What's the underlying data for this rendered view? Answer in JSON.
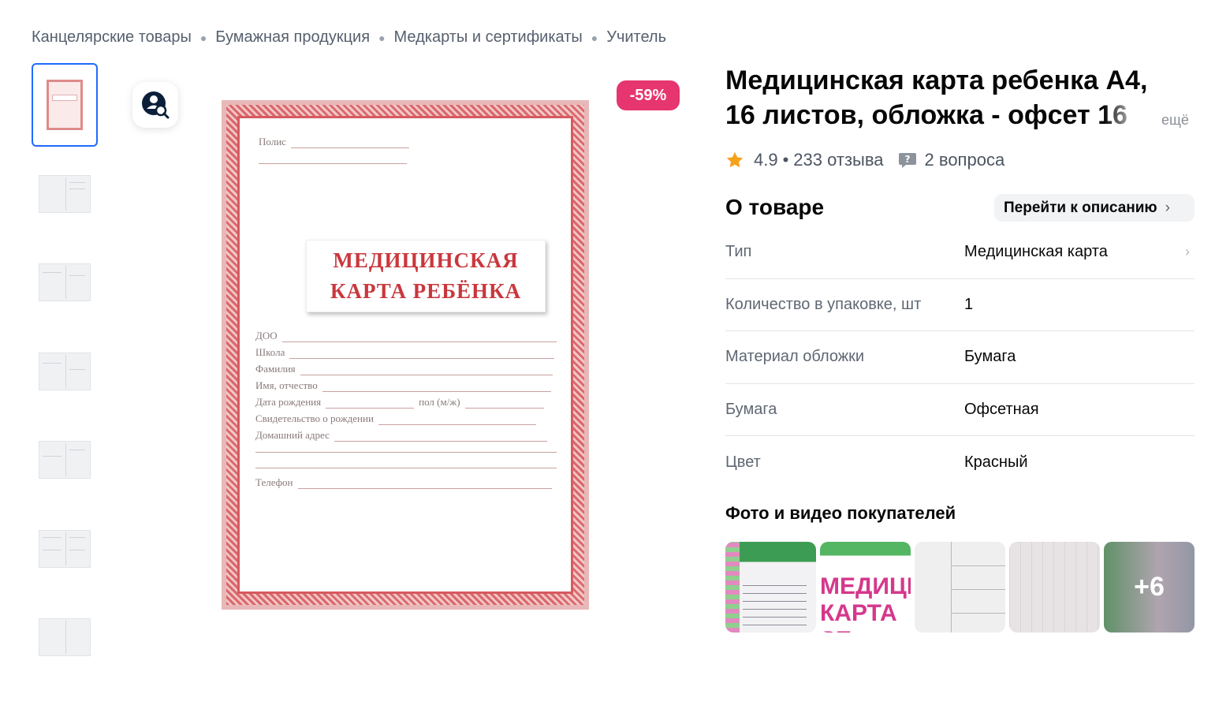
{
  "breadcrumbs": [
    "Канцелярские товары",
    "Бумажная продукция",
    "Медкарты и сертификаты",
    "Учитель"
  ],
  "discount_badge": "-59%",
  "cover": {
    "title_line1": "МЕДИЦИНСКАЯ",
    "title_line2": "КАРТА РЕБЁНКА",
    "field_polis": "Полис",
    "field_doo": "ДОО",
    "field_school": "Школа",
    "field_surname": "Фамилия",
    "field_name": "Имя, отчество",
    "field_birth": "Дата рождения",
    "field_sex": "пол (м/ж)",
    "field_cert": "Свидетельство о рождении",
    "field_address": "Домашний адрес",
    "field_phone": "Телефон"
  },
  "product": {
    "title": "Медицинская карта ребенка А4, 16 листов, обложка - офсет 16",
    "more": "ещё",
    "rating": "4.9",
    "reviews": "233 отзыва",
    "questions": "2 вопроса"
  },
  "about": {
    "title": "О товаре",
    "goto_description": "Перейти к описанию",
    "properties": [
      {
        "name": "Тип",
        "value": "Медицинская карта"
      },
      {
        "name": "Количество в упаковке, шт",
        "value": "1"
      },
      {
        "name": "Материал обложки",
        "value": "Бумага"
      },
      {
        "name": "Бумага",
        "value": "Офсетная"
      },
      {
        "name": "Цвет",
        "value": "Красный"
      }
    ]
  },
  "ugc": {
    "title": "Фото и видео покупателей",
    "ugc2_text1": "МЕДИЦИ",
    "ugc2_text2": "КАРТА РЕ",
    "more_count": "+6"
  },
  "colors": {
    "accent_blue": "#1f6bff",
    "discount_pink": "#e6356f",
    "star": "#f7a21b",
    "cover_red": "#d65a60"
  },
  "icons": [
    "search-by-photo-icon",
    "star-icon",
    "question-icon",
    "chevron-right-icon"
  ]
}
